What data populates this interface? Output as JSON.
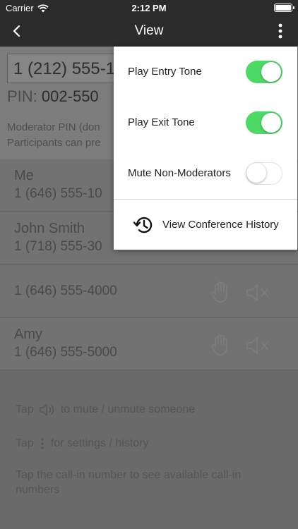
{
  "status_bar": {
    "carrier": "Carrier",
    "time": "2:12 PM"
  },
  "nav": {
    "title": "View"
  },
  "conference": {
    "number": "1 (212) 555-1",
    "pin_label": "PIN:",
    "pin_value": "002-550",
    "moderator_note": "Moderator PIN (don",
    "participants_note": "Participants can pre"
  },
  "participants": [
    {
      "name": "Me",
      "phone": "1 (646) 555-10"
    },
    {
      "name": "John Smith",
      "phone": "1 (718) 555-30"
    },
    {
      "name": "",
      "phone": "1 (646) 555-4000"
    },
    {
      "name": "Amy",
      "phone": "1 (646) 555-5000"
    }
  ],
  "hints": {
    "mute_pre": "Tap",
    "mute_post": "to mute / unmute someone",
    "settings_pre": "Tap",
    "settings_post": "for settings / history",
    "callin": "Tap the call-in number to see available call-in numbers"
  },
  "menu": {
    "items": [
      {
        "label": "Play Entry Tone",
        "on": true
      },
      {
        "label": "Play Exit Tone",
        "on": true
      },
      {
        "label": "Mute Non-Moderators",
        "on": false
      }
    ],
    "history_label": "View Conference History"
  },
  "colors": {
    "toggle_on": "#4cd964",
    "nav_bg": "#2b2b2b"
  }
}
